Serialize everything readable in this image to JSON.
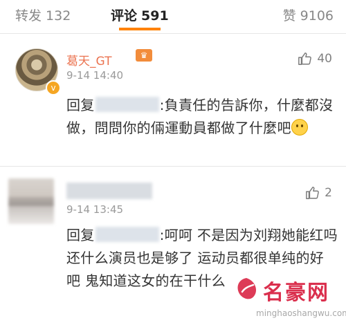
{
  "tabs": {
    "repost": {
      "label": "转发",
      "count": "132"
    },
    "comments": {
      "label": "评论",
      "count": "591"
    },
    "likes": {
      "label": "赞",
      "count": "9106"
    }
  },
  "comments": [
    {
      "username": "葛天_GT",
      "time": "9-14 14:40",
      "likes": "40",
      "reply_prefix": "回复",
      "text": ":負責任的告訴你，什麼都沒做，問問你的倆運動員都做了什麼吧",
      "has_emoji": true
    },
    {
      "username": "",
      "time": "9-14 13:45",
      "likes": "2",
      "reply_prefix": "回复",
      "text": ":呵呵 不是因为刘翔她能红吗 还什么演员也是够了 运动员都很单纯的好吧 鬼知道这女的在干什么"
    }
  ],
  "watermark": {
    "title": "名豪网",
    "url": "minghaoshangwu.com"
  },
  "colors": {
    "accent": "#ff8200",
    "username": "#eb7350",
    "watermark": "#d7193a"
  }
}
